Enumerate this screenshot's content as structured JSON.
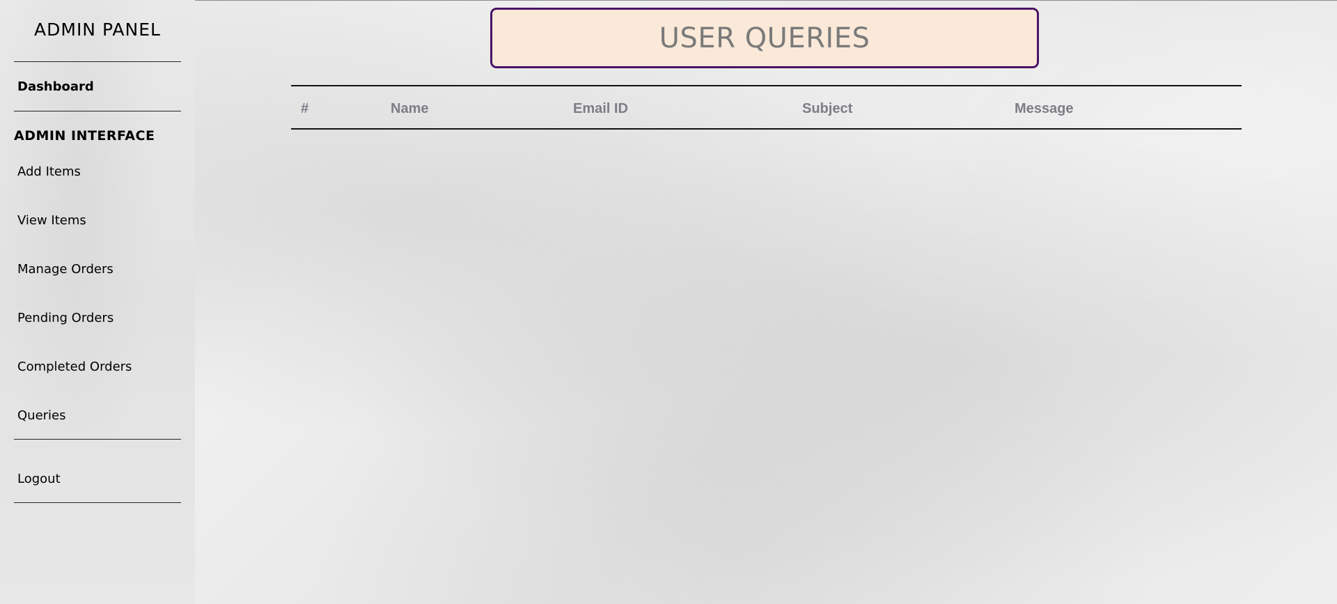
{
  "sidebar": {
    "brand": "ADMIN PANEL",
    "dashboard": "Dashboard",
    "section_title": "ADMIN INTERFACE",
    "items": [
      {
        "label": "Add Items"
      },
      {
        "label": "View Items"
      },
      {
        "label": "Manage Orders"
      },
      {
        "label": "Pending Orders"
      },
      {
        "label": "Completed Orders"
      },
      {
        "label": "Queries"
      }
    ],
    "logout": "Logout"
  },
  "main": {
    "title": "USER QUERIES",
    "table": {
      "columns": [
        "#",
        "Name",
        "Email ID",
        "Subject",
        "Message"
      ],
      "rows": []
    }
  },
  "colors": {
    "header_background": "#fae9d8",
    "header_border": "#4a1466",
    "header_text": "#7a7a7a",
    "table_header_text": "#7d7d86"
  }
}
